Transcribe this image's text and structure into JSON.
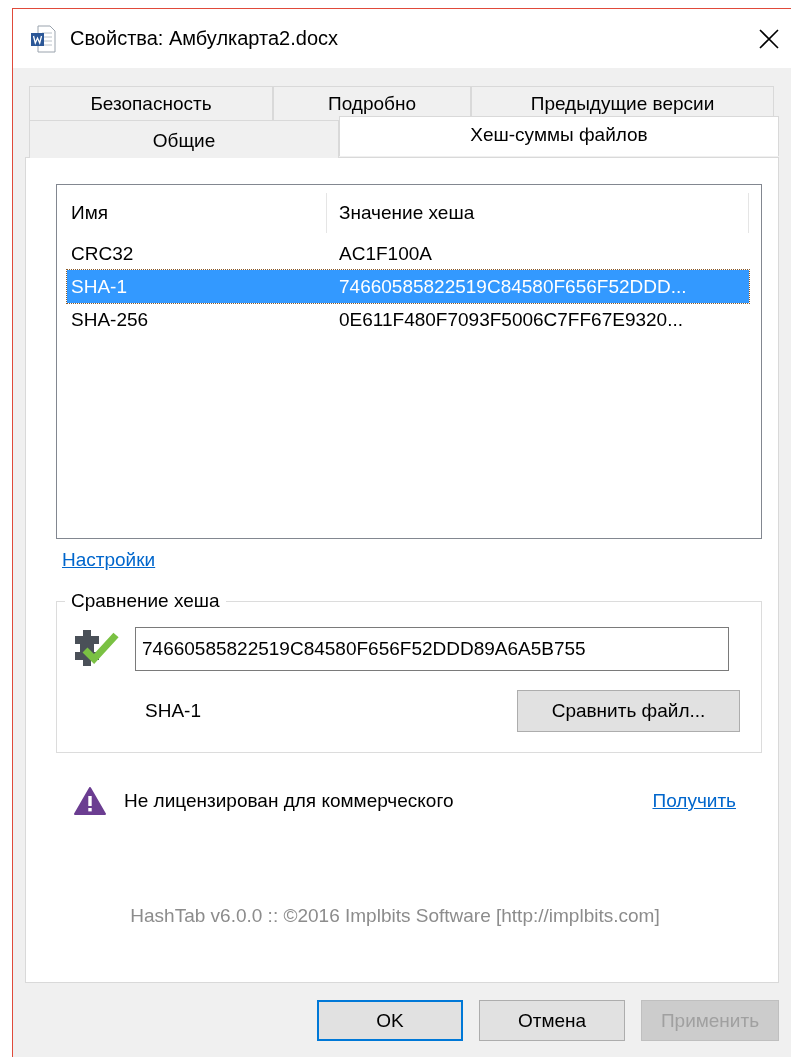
{
  "window": {
    "title": "Свойства: Амбулкарта2.docx"
  },
  "tab_rows": [
    [
      {
        "label": "Безопасность",
        "selected": false
      },
      {
        "label": "Подробно",
        "selected": false
      },
      {
        "label": "Предыдущие версии",
        "selected": false
      }
    ],
    [
      {
        "label": "Общие",
        "selected": false
      },
      {
        "label": "Хеш-суммы файлов",
        "selected": true
      }
    ]
  ],
  "hash_list": {
    "columns": [
      "Имя",
      "Значение хеша"
    ],
    "rows": [
      {
        "name": "CRC32",
        "value": "AC1F100A",
        "selected": false
      },
      {
        "name": "SHA-1",
        "value": "74660585822519C84580F656F52DDD...",
        "selected": true
      },
      {
        "name": "SHA-256",
        "value": "0E611F480F7093F5006C7FF67E9320...",
        "selected": false
      }
    ]
  },
  "settings_link": "Настройки",
  "compare": {
    "title": "Сравнение хеша",
    "value": "74660585822519C84580F656F52DDD89A6A5B755",
    "matched": true,
    "algorithm": "SHA-1",
    "button": "Сравнить файл..."
  },
  "license": {
    "text": "Не лицензирован для коммерческого",
    "link": "Получить"
  },
  "footer": "HashTab v6.0.0 :: ©2016 Implbits Software [http://implbits.com]",
  "buttons": [
    {
      "label": "OK",
      "default": true,
      "disabled": false
    },
    {
      "label": "Отмена",
      "default": false,
      "disabled": false
    },
    {
      "label": "Применить",
      "default": false,
      "disabled": true
    }
  ]
}
